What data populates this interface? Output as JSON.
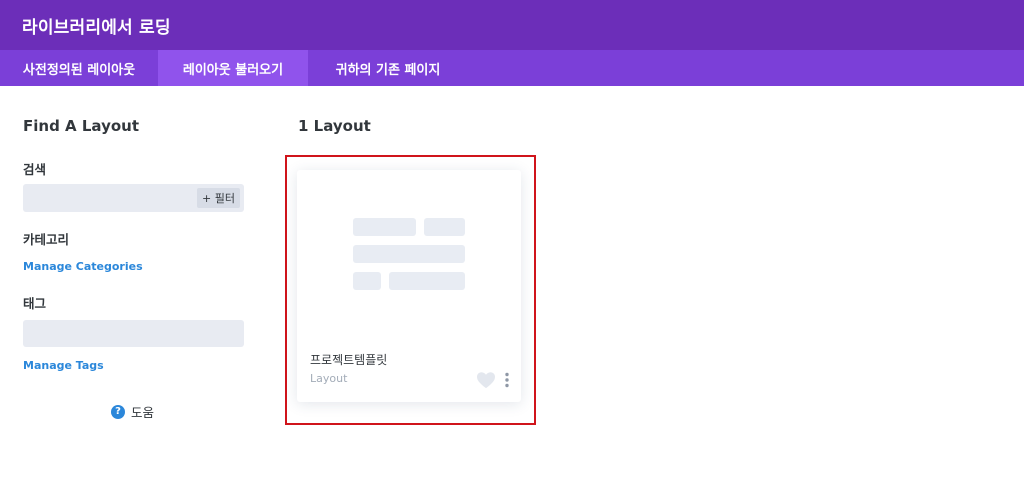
{
  "header": {
    "title": "라이브러리에서 로딩"
  },
  "tabs": [
    {
      "label": "사전정의된 레이아웃"
    },
    {
      "label": "레이아웃 불러오기"
    },
    {
      "label": "귀하의 기존 페이지"
    }
  ],
  "sidebar": {
    "heading": "Find A Layout",
    "search_label": "검색",
    "filter_label": "+ 필터",
    "category_label": "카테고리",
    "manage_categories": "Manage Categories",
    "tag_label": "태그",
    "manage_tags": "Manage Tags",
    "help_label": "도움"
  },
  "results": {
    "count_label": "1 Layout",
    "cards": [
      {
        "title": "프로젝트템플릿",
        "type": "Layout"
      }
    ]
  },
  "colors": {
    "header_bg": "#6c2eb9",
    "tabbar_bg": "#7b3fd8",
    "active_tab_bg": "#9053ec",
    "link": "#2b87da",
    "highlight": "#d0141b"
  },
  "icons": [
    "help-icon",
    "heart-icon",
    "more-options-icon",
    "layout-placeholder-icon"
  ]
}
